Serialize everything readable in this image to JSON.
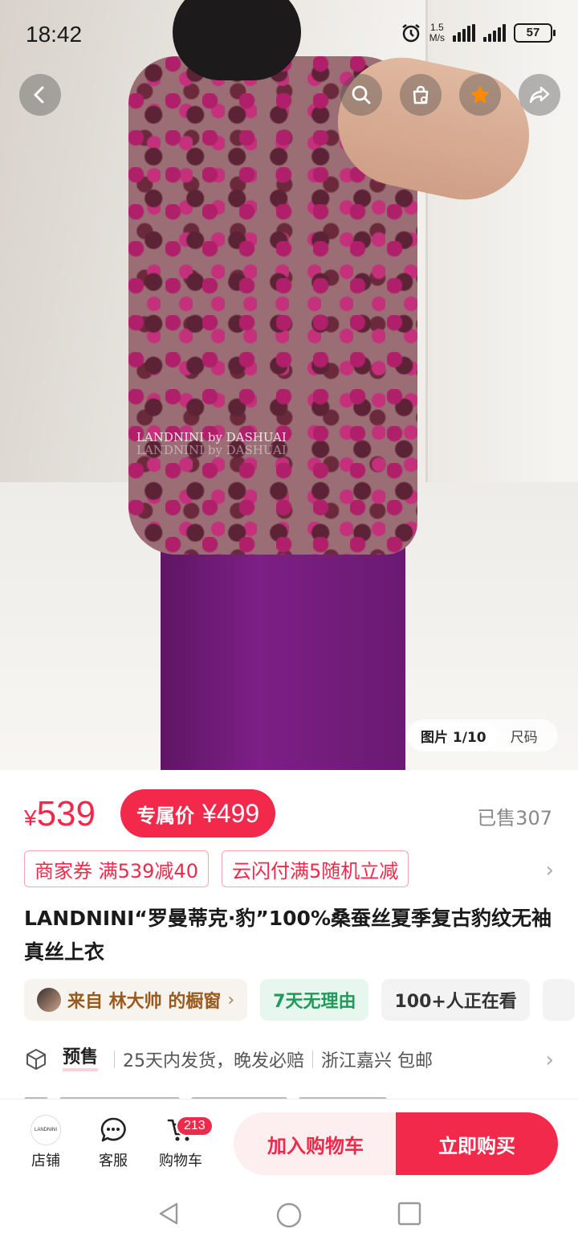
{
  "status_bar": {
    "time": "18:42",
    "net_speed_value": "1.5",
    "net_speed_unit": "M/s",
    "battery": "57"
  },
  "gallery": {
    "watermark_1": "LANDNINI by DASHUAI",
    "watermark_2": "LANDNINI by DASHUAI",
    "counter": "图片 1/10",
    "size_tab": "尺码"
  },
  "price": {
    "currency": "¥",
    "amount": "539",
    "promo_label": "专属价",
    "promo_value": "¥499",
    "sold": "已售307"
  },
  "coupons": [
    "商家券 满539减40",
    "云闪付满5随机立减"
  ],
  "product": {
    "title": "LANDNINI“罗曼蒂克·豹”100%桑蚕丝夏季复古豹纹无袖真丝上衣"
  },
  "tags": {
    "store": "来自 林大帅 的橱窗",
    "return": "7天无理由",
    "viewing": "100+人正在看"
  },
  "shipping": {
    "presale": "预售",
    "delivery": "25天内发货，晚发必赔",
    "origin": "浙江嘉兴 包邮"
  },
  "action_bar": {
    "store_label": "店铺",
    "store_logo": "LANDNINI",
    "service_label": "客服",
    "cart_label": "购物车",
    "cart_badge": "213",
    "add_cart": "加入购物车",
    "buy_now": "立即购买"
  },
  "colors": {
    "accent": "#f2294a",
    "return_green": "#1f9a59",
    "store_brown": "#9a5a1c"
  },
  "icons": [
    "back-arrow-icon",
    "search-icon",
    "bag-icon",
    "star-icon",
    "share-icon",
    "chevron-right-icon",
    "package-icon",
    "chat-icon",
    "cart-icon",
    "nav-back-icon",
    "nav-home-icon",
    "nav-recent-icon"
  ]
}
